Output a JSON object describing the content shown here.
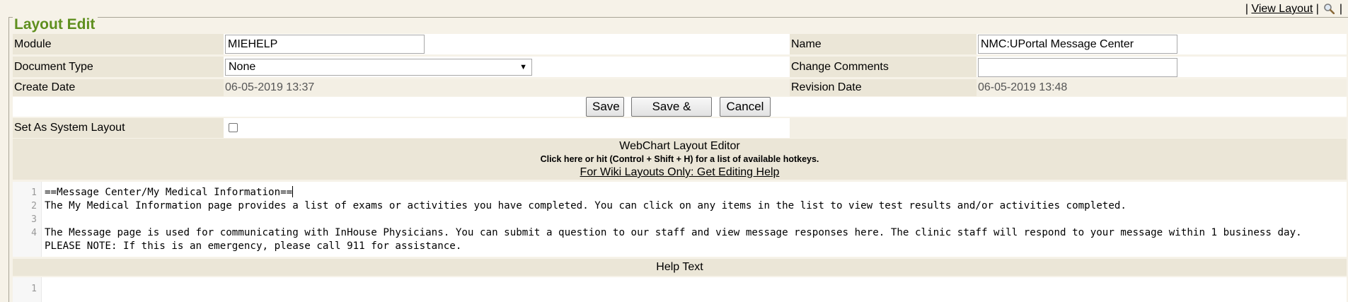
{
  "top_links": {
    "sep1": "|",
    "view_layout": "View Layout",
    "sep2": "|",
    "sep3": "|",
    "search_icon": "magnifier-icon"
  },
  "panel": {
    "title": "Layout Edit"
  },
  "form": {
    "module_label": "Module",
    "module_value": "MIEHELP",
    "name_label": "Name",
    "name_value": "NMC:UPortal Message Center",
    "doctype_label": "Document Type",
    "doctype_value": "None",
    "change_comments_label": "Change Comments",
    "change_comments_value": "",
    "create_date_label": "Create Date",
    "create_date_value": "06-05-2019 13:37",
    "revision_date_label": "Revision Date",
    "revision_date_value": "06-05-2019 13:48",
    "system_layout_label": "Set As System Layout",
    "system_layout_checked": false
  },
  "buttons": {
    "save": "Save",
    "save_close": "Save & Close",
    "cancel": "Cancel"
  },
  "editor_header": {
    "title": "WebChart Layout Editor",
    "hotkeys": "Click here or hit (Control + Shift + H) for a list of available hotkeys.",
    "wiki_help": "For Wiki Layouts Only: Get Editing Help"
  },
  "editor": {
    "lines": [
      {
        "num": "1",
        "text": "==Message Center/My Medical Information=="
      },
      {
        "num": "2",
        "text": "The My Medical Information page provides a list of exams or activities you have completed. You can click on any items in the list to view test results and/or activities completed."
      },
      {
        "num": "3",
        "text": ""
      },
      {
        "num": "4",
        "text": "The Message page is used for communicating with InHouse Physicians. You can submit a question to our staff and view message responses here. The clinic staff will respond to your message within 1 business day. PLEASE NOTE: If this is an emergency, please call 911 for assistance."
      }
    ]
  },
  "help_text": {
    "title": "Help Text",
    "lines": [
      {
        "num": "1",
        "text": ""
      }
    ]
  }
}
